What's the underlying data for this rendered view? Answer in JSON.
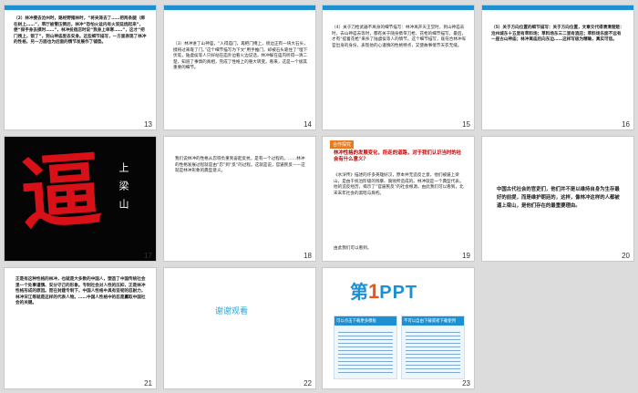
{
  "slides": [
    {
      "number": "13",
      "text": "（2）林冲要去沧州时，路经野猪林时，“将夹笼去了……把两条腿（绑在树上……”，草厅被雪压倒后，林冲“恐怕火盆内有火炭延烧起来”，便“探手身去摸时……”，林冲投宿店时说“我身上单寒……”，这才“把门拽上，锁了”，到山神庙里去安身。这些细节描写，一方面表现了林冲的性格，另一方面也为后面的情节发展作了铺垫。"
    },
    {
      "number": "14",
      "text": "（3）林冲进了山神庙，“入得庙门，再把门掩上，傍边正有一块大石头，掇将过来靠了门。”这个细节描写为下文“用手推门，却被石头靠住了”埋下伏笔，陆虞侯等人只好站在庙外边看火边说话，林冲躲在庙内听得一清二楚，知道了事情的真相，完成了性格上的重大转变。看来，这是一个极其重要的细节。"
    },
    {
      "number": "15",
      "text": "（4）关于刀枪武器不离身的细节描写：林冲离开天王堂时，到山神庙去时，去山神庙去等时，都有关于随身携带刀枪、花枪的细节描写。最后，才有“提着花枪”来杀了陆虞侯等人的情节。这个细节描写，既符合林冲军官出身的身份，表现他的心谨慎的性格特点，又使故事情节天衣无缝。"
    },
    {
      "number": "16",
      "text": "（5）关于方向位置的细节描写：关于方向位置，文章交代得清清楚楚：沧州城东十五里有草料场；草料场东三二里有酒店；草料场东面不远有一座古山神庙；林冲离庙后向东边……这样写极为精确，真实可信。"
    },
    {
      "number": "17",
      "char": "逼",
      "vertical": "上梁山"
    },
    {
      "number": "18",
      "text": "我们说林冲的性格从忍辱负重到奋起反抗，是有一个过程的。……林冲的性格发展过程就是由“忍”到“反”的过程。这就是说，官逼民反——这就是林冲形象的典型意义。",
      "highlight": "官逼民反"
    },
    {
      "number": "19",
      "tag": "合作探究",
      "title": "林冲性格的发展变化，所走的道路，对于我们认识当时的社会有什么意义？",
      "body": "《水浒传》描述的许多英雄好汉，原本并无造反之意，他们被逼上梁山，是由于统治阶级的残暴、腐败所造成的。林冲就是一个典型代表。他的造反经历，揭示了“官逼民反”的社会根源。由此我们可以看到，北宋末年社会的黑暗与腐朽。",
      "end": "由此我们可以看到。"
    },
    {
      "number": "20",
      "text": "中国古代社会的官吏们，他们并不是以维持自身为生存最好的前提，而是维护朝廷的，这样，像林冲这样的人都被逼上梁山，是他们存在的最重要理由。"
    },
    {
      "number": "21",
      "text": "正是有这种性格的林冲，也就是大多数的中国人，塑造了中国传统社会里一个处事谨慎、安分守己的形象。专制社会对人性的压抑，正是林冲性格形成的原因。而在封建专制下，中国人性格中具有坚韧的忍耐力，林冲宋江等就是这样的代表人物。……中国人性格中的忍是赢取中国社会的关键。"
    },
    {
      "number": "22",
      "thanks": "谢谢观看"
    },
    {
      "number": "23",
      "logo_digit": "第",
      "logo_one": "1",
      "logo_ppt": "PPT",
      "caption_left": "可以点击下载更多模板",
      "caption_right": "不可以自由下载或者下载使用"
    }
  ]
}
